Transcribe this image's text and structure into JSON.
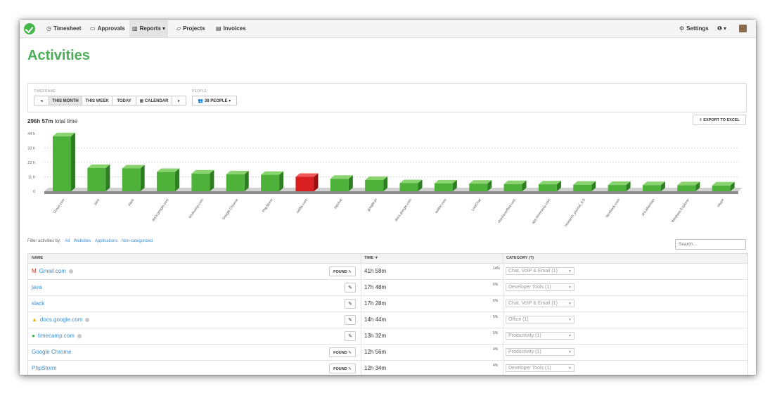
{
  "nav": {
    "items": [
      {
        "label": "Timesheet",
        "icon": "clock-icon",
        "glyph": "◷"
      },
      {
        "label": "Approvals",
        "icon": "inbox-icon",
        "glyph": "▭"
      },
      {
        "label": "Reports ▾",
        "icon": "bar-chart-icon",
        "glyph": "▥"
      },
      {
        "label": "Projects",
        "icon": "folder-icon",
        "glyph": "▱"
      },
      {
        "label": "Invoices",
        "icon": "invoice-icon",
        "glyph": "▤"
      }
    ],
    "settings_label": "Settings",
    "help_label": "❶ ▾"
  },
  "page": {
    "title": "Activities"
  },
  "filters": {
    "timeframe_label": "TIMEFRAME:",
    "people_label": "PEOPLE:",
    "prev": "◂",
    "this_month": "THIS MONTH",
    "this_week": "THIS WEEK",
    "today": "TODAY",
    "calendar": "CALENDAR",
    "next": "▸",
    "people_button": "38 PEOPLE ▾"
  },
  "summary": {
    "total_value": "296h 57m",
    "total_suffix": " total time",
    "export_label": "EXPORT TO EXCEL"
  },
  "chart_data": {
    "type": "bar",
    "yticks": [
      "44 h",
      "33 h",
      "22 h",
      "11 h",
      "0"
    ],
    "ylim": [
      0,
      44
    ],
    "categories": [
      "Gmail.com",
      "java",
      "slack",
      "docs.google.com",
      "timecamp.com",
      "Google Chrome",
      "PhpStorm",
      "netflix.com",
      "hipchat",
      "google.pl",
      "docs.google.com",
      "twitter.com",
      "LiveChat",
      "stackoverflow.com",
      "app.timecamp.com",
      "research_journal_8.5",
      "facebook.com",
      "jira.atlassian",
      "Windows Explorer",
      "skype"
    ],
    "values": [
      41.98,
      17.8,
      17.47,
      14.73,
      13.53,
      12.93,
      12.57,
      11.0,
      9.5,
      8.6,
      6.2,
      6.0,
      5.8,
      5.5,
      5.3,
      5.0,
      4.8,
      4.7,
      4.6,
      4.4
    ],
    "highlight": 7,
    "colors": {
      "bar": "#52b63c",
      "highlight": "#e02020"
    }
  },
  "table": {
    "filter_label": "Filter activities by:",
    "filter_links": [
      "All",
      "Websites",
      "Applications",
      "Non-categorized"
    ],
    "search_placeholder": "Search...",
    "headers": {
      "name": "NAME",
      "time": "TIME ▼",
      "category": "CATEGORY (?)"
    },
    "rows": [
      {
        "name": "Gmail.com",
        "icon": "gmail-icon",
        "glyph": "M",
        "glyph_color": "#d93025",
        "info": true,
        "found": true,
        "time": "41h 58m",
        "pct": "14%",
        "category": "Chat, VoIP & Email (1)"
      },
      {
        "name": "java",
        "icon": "",
        "glyph": "",
        "glyph_color": "",
        "info": false,
        "found": false,
        "time": "17h 48m",
        "pct": "6%",
        "category": "Developer Tools (1)"
      },
      {
        "name": "slack",
        "icon": "",
        "glyph": "",
        "glyph_color": "",
        "info": false,
        "found": false,
        "time": "17h 28m",
        "pct": "6%",
        "category": "Chat, VoIP & Email (1)"
      },
      {
        "name": "docs.google.com",
        "icon": "google-drive-icon",
        "glyph": "▲",
        "glyph_color": "#e8b30c",
        "info": true,
        "found": false,
        "time": "14h 44m",
        "pct": "5%",
        "category": "Office (1)"
      },
      {
        "name": "timecamp.com",
        "icon": "timecamp-icon",
        "glyph": "●",
        "glyph_color": "#45b649",
        "info": true,
        "found": false,
        "time": "13h 32m",
        "pct": "5%",
        "category": "Productivity (1)"
      },
      {
        "name": "Google Chrome",
        "icon": "",
        "glyph": "",
        "glyph_color": "",
        "info": false,
        "found": true,
        "time": "12h 56m",
        "pct": "4%",
        "category": "Productivity (1)"
      },
      {
        "name": "PhpStorm",
        "icon": "",
        "glyph": "",
        "glyph_color": "",
        "info": false,
        "found": true,
        "time": "12h 34m",
        "pct": "4%",
        "category": "Developer Tools (1)"
      }
    ],
    "found_label": "FOUND ✎",
    "tag_glyph": "✎"
  }
}
